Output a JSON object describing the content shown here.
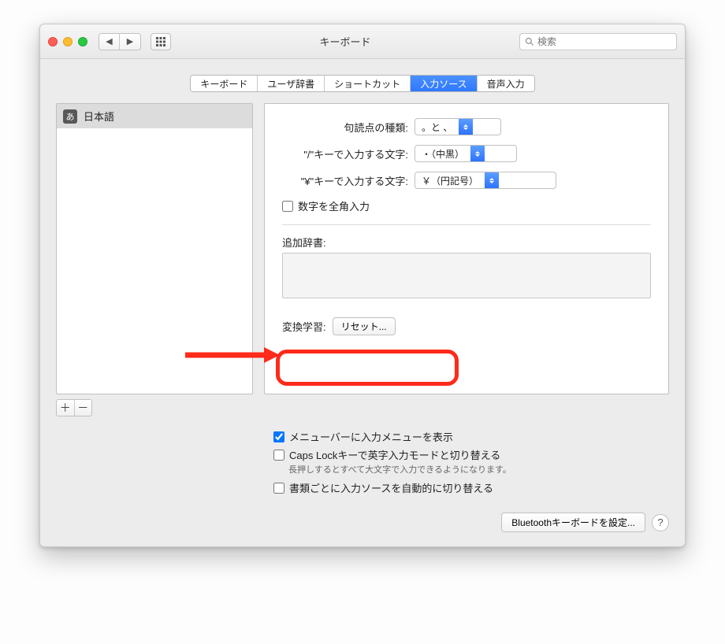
{
  "window": {
    "title": "キーボード"
  },
  "search": {
    "placeholder": "検索"
  },
  "tabs": {
    "items": [
      {
        "label": "キーボード"
      },
      {
        "label": "ユーザ辞書"
      },
      {
        "label": "ショートカット"
      },
      {
        "label": "入力ソース"
      },
      {
        "label": "音声入力"
      }
    ],
    "active_index": 3
  },
  "sidebar": {
    "items": [
      {
        "icon": "あ",
        "label": "日本語"
      }
    ]
  },
  "settings": {
    "punctuation": {
      "label": "句読点の種類:",
      "value": "。と 、"
    },
    "slash_key": {
      "label": "\"/\"キーで入力する文字:",
      "value": "・（中黒）"
    },
    "yen_key": {
      "label": "\"¥\"キーで入力する文字:",
      "value": "￥（円記号）"
    },
    "fullwidth_digits": {
      "label": "数字を全角入力",
      "checked": false
    },
    "additional_dict": {
      "label": "追加辞書:"
    },
    "conversion": {
      "label": "変換学習:",
      "button": "リセット..."
    }
  },
  "lower_options": {
    "show_menu": {
      "label": "メニューバーに入力メニューを表示",
      "checked": true
    },
    "caps_switch": {
      "label": "Caps Lockキーで英字入力モードと切り替える",
      "checked": false
    },
    "caps_hint": "長押しするとすべて大文字で入力できるようになります。",
    "per_doc": {
      "label": "書類ごとに入力ソースを自動的に切り替える",
      "checked": false
    }
  },
  "footer": {
    "bluetooth": "Bluetoothキーボードを設定..."
  }
}
